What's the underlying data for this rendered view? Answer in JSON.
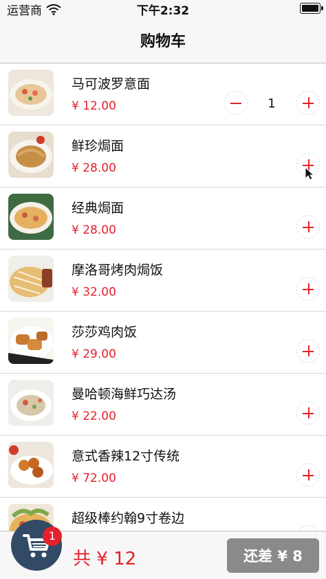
{
  "status_bar": {
    "carrier": "运营商",
    "time": "下午2:32"
  },
  "nav": {
    "title": "购物车"
  },
  "items": [
    {
      "name": "马可波罗意面",
      "price": "¥ 12.00",
      "quantity": "1"
    },
    {
      "name": "鲜珍焗面",
      "price": "¥ 28.00"
    },
    {
      "name": "经典焗面",
      "price": "¥ 28.00"
    },
    {
      "name": "摩洛哥烤肉焗饭",
      "price": "¥ 32.00"
    },
    {
      "name": "莎莎鸡肉饭",
      "price": "¥ 29.00"
    },
    {
      "name": "曼哈顿海鲜巧达汤",
      "price": "¥ 22.00"
    },
    {
      "name": "意式香辣12寸传统",
      "price": "¥ 72.00"
    },
    {
      "name": "超级棒约翰9寸卷边"
    }
  ],
  "cart": {
    "badge_count": "1",
    "total": "共 ¥ 12",
    "checkout_label": "还差 ¥ 8"
  },
  "colors": {
    "accent": "#e4202b",
    "cart_button": "#334a66",
    "checkout_disabled": "#8a8a8a"
  }
}
